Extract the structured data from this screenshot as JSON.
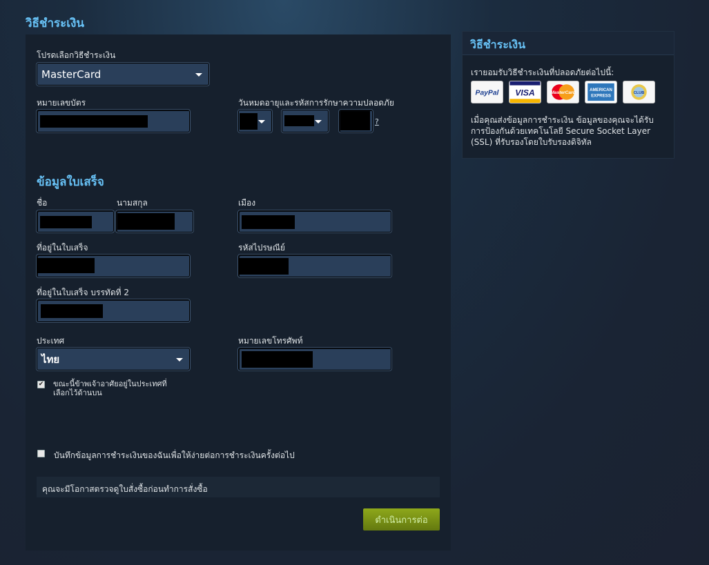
{
  "page": {
    "title": "วิธีชำระเงิน"
  },
  "payment": {
    "method_label": "โปรดเลือกวิธีชำระเงิน",
    "method_value": "MasterCard",
    "card_number_label": "หมายเลขบัตร",
    "expiry_label": "วันหมดอายุและรหัสการรักษาความปลอดภัย",
    "help_link": "?"
  },
  "billing": {
    "section_title": "ข้อมูลใบเสร็จ",
    "first_name_label": "ชื่อ",
    "last_name_label": "นามสกุล",
    "city_label": "เมือง",
    "address_label": "ที่อยู่ในใบเสร็จ",
    "postal_label": "รหัสไปรษณีย์",
    "address2_label": "ที่อยู่ในใบเสร็จ บรรทัดที่ 2",
    "country_label": "ประเทศ",
    "country_value": "ไทย",
    "phone_label": "หมายเลขโทรศัพท์",
    "reside_line1": "ขณะนี้ข้าพเจ้าอาศัยอยู่ในประเทศที่",
    "reside_line2": "เลือกไว้ด้านบน",
    "reside_checked": true,
    "save_label": "บันทึกข้อมูลการชำระเงินของฉันเพื่อให้ง่ายต่อการชำระเงินครั้งต่อไป",
    "save_checked": false
  },
  "notice": "คุณจะมีโอกาสตรวจดูใบสั่งซื้อก่อนทำการสั่งซื้อ",
  "continue_label": "ดำเนินการต่อ",
  "sidebar": {
    "title": "วิธีชำระเงิน",
    "accept_text": "เรายอมรับวิธีชำระเงินที่ปลอดภัยต่อไปนี้:",
    "ssl_line1": "เมื่อคุณส่งข้อมูลการชำระเงิน ข้อมูลของคุณจะได้รับ",
    "ssl_line2": "การป้องกันด้วยเทคโนโลยี Secure Socket Layer",
    "ssl_line3": "(SSL) ที่รับรองโดยใบรับรองดิจิทัล",
    "logos": {
      "paypal": "PayPal",
      "visa": "VISA",
      "mastercard": "MasterCard",
      "amex_1": "AMERICAN",
      "amex_2": "EXPRESS",
      "jcb": "CLUB"
    }
  }
}
